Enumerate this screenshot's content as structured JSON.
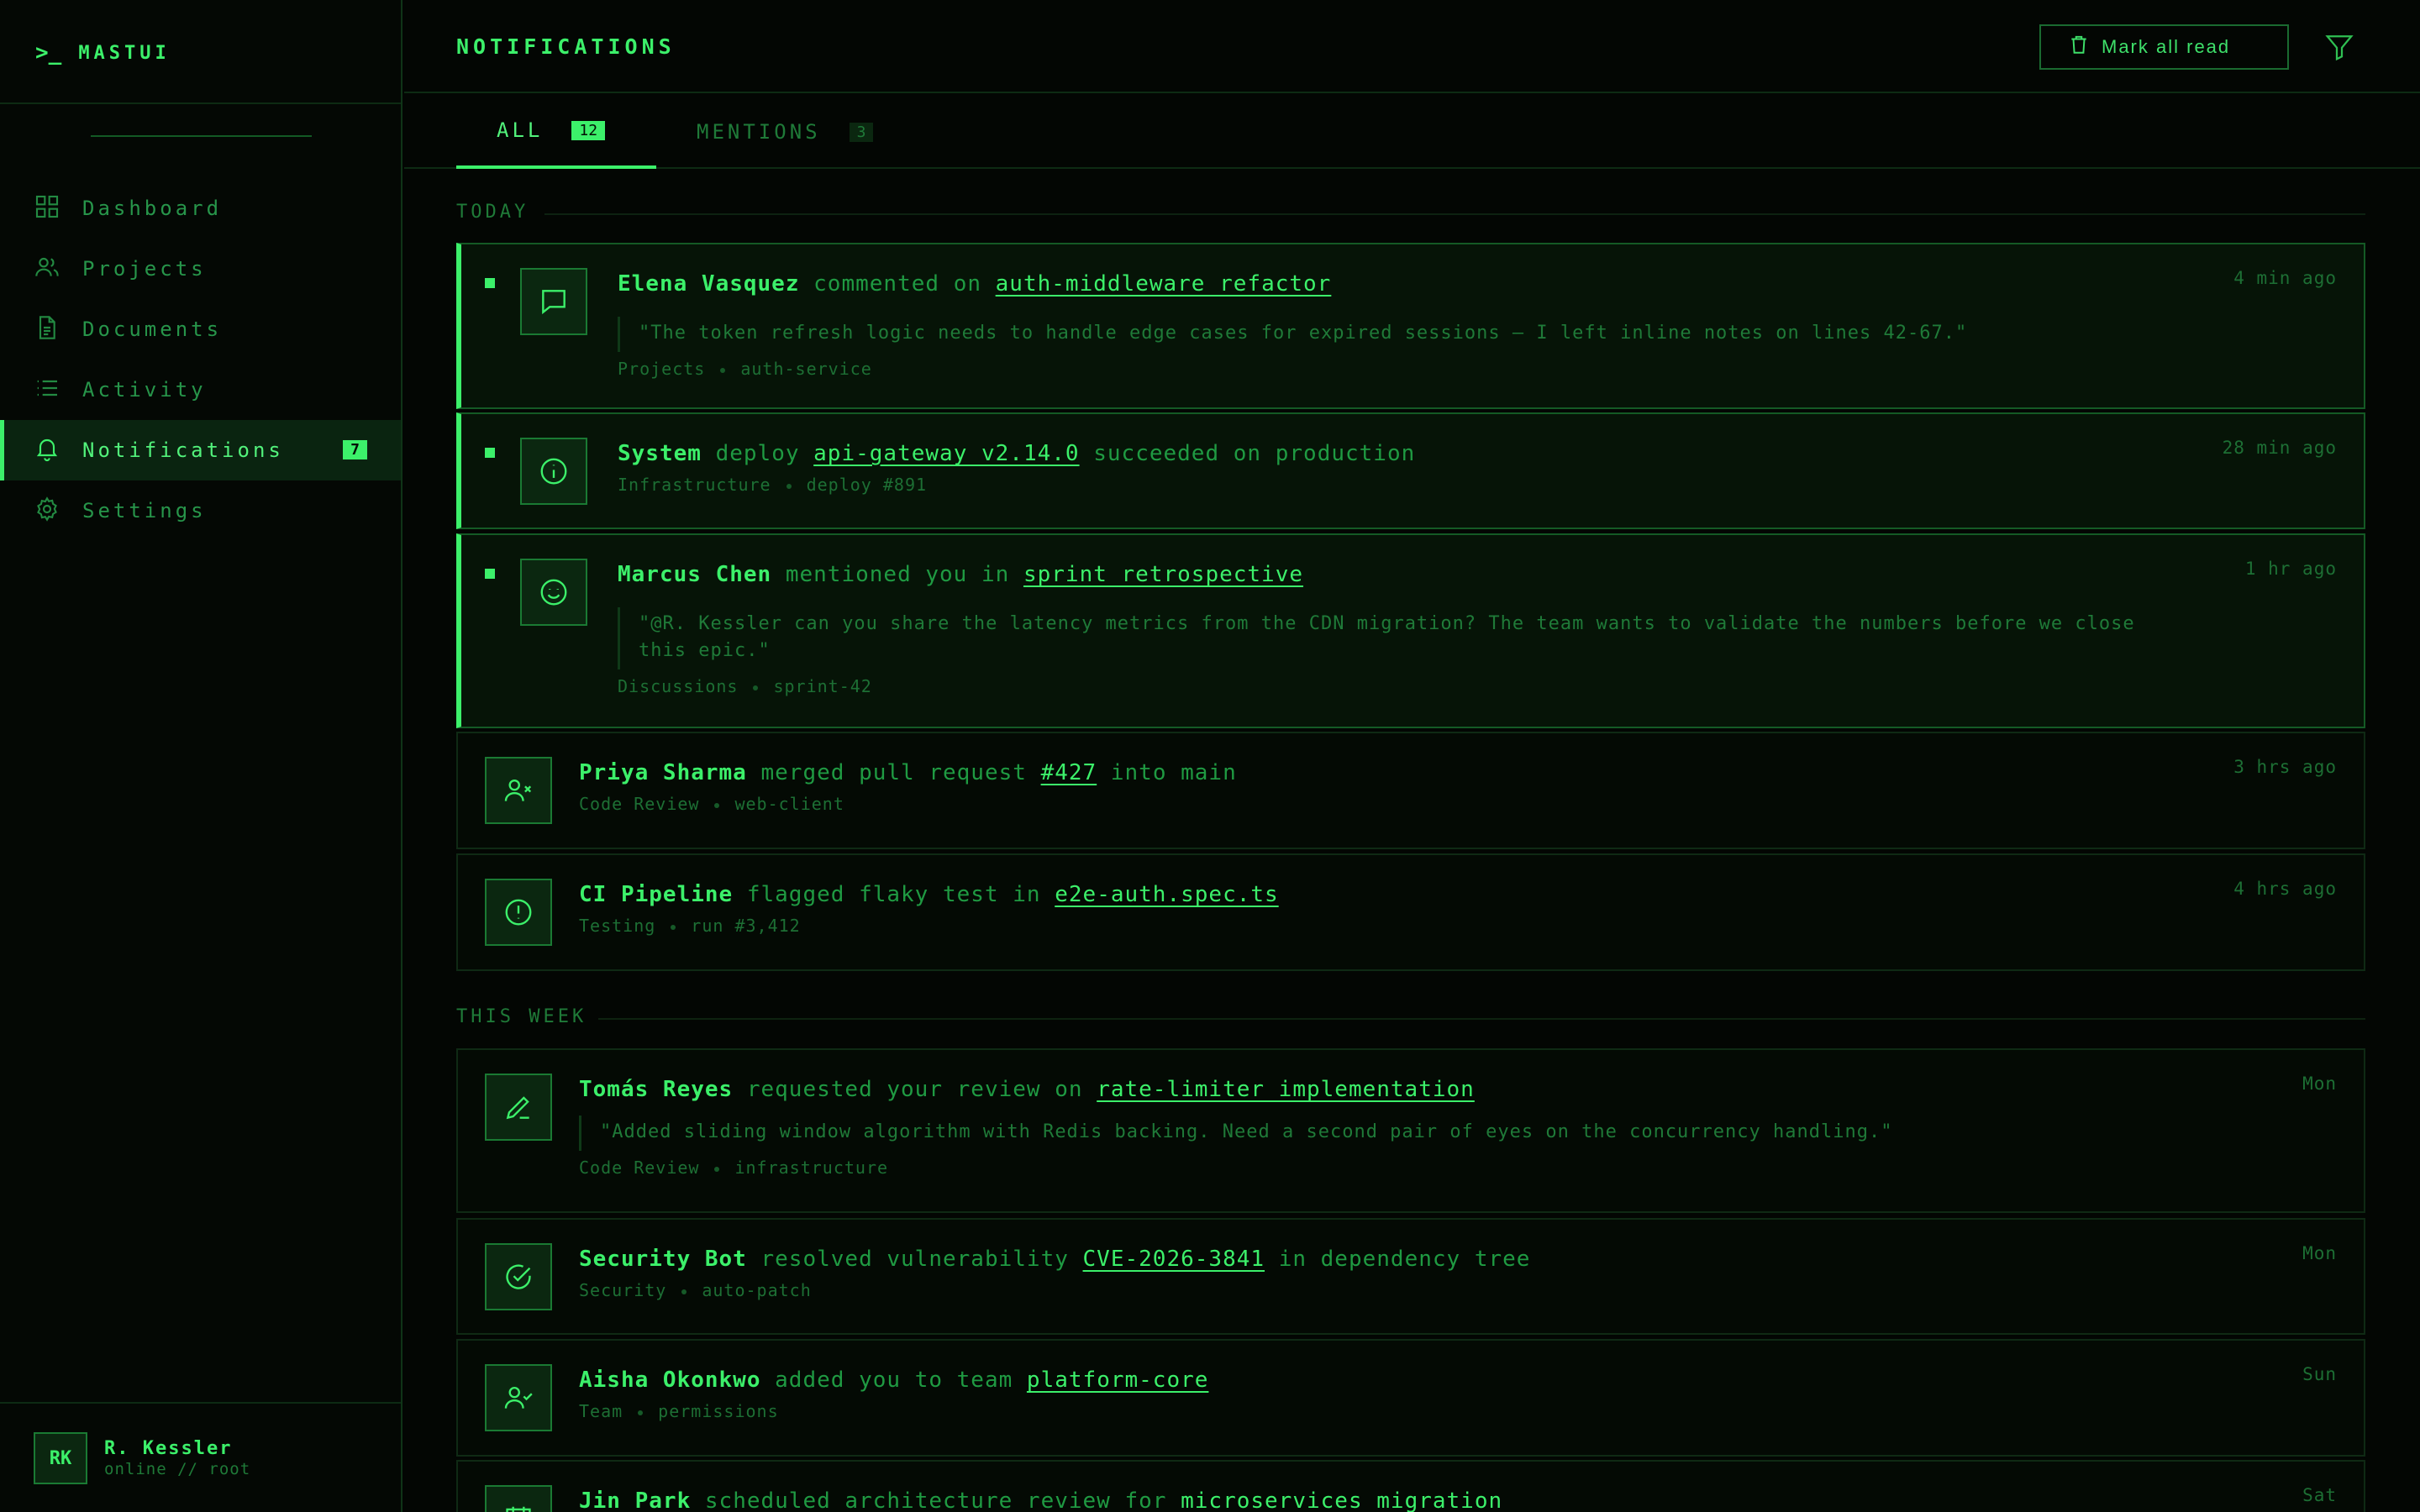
{
  "brand": {
    "prompt": ">_",
    "name": "MASTUI"
  },
  "nav": {
    "items": [
      {
        "label": "Dashboard",
        "icon": "grid-icon"
      },
      {
        "label": "Projects",
        "icon": "users-icon"
      },
      {
        "label": "Documents",
        "icon": "document-icon"
      },
      {
        "label": "Activity",
        "icon": "list-icon"
      },
      {
        "label": "Notifications",
        "icon": "bell-icon",
        "badge": "7",
        "active": true
      },
      {
        "label": "Settings",
        "icon": "gear-icon"
      }
    ]
  },
  "user": {
    "initials": "RK",
    "name": "R. Kessler",
    "status": "online // root"
  },
  "header": {
    "title": "NOTIFICATIONS",
    "mark_all_read": "Mark all read"
  },
  "tabs": [
    {
      "label": "ALL",
      "count": "12",
      "active": true
    },
    {
      "label": "MENTIONS",
      "count": "3",
      "active": false
    }
  ],
  "sections": [
    {
      "label": "TODAY",
      "items": [
        {
          "actor": "Elena Vasquez",
          "action": "commented on",
          "target": "auth-middleware refactor",
          "suffix": "",
          "quote": "\"The token refresh logic needs to handle edge cases for expired sessions — I left inline notes on lines 42-67.\"",
          "meta": [
            "Projects",
            "auth-service"
          ],
          "time": "4 min ago",
          "unread": true,
          "icon": "comment-icon"
        },
        {
          "actor": "System",
          "action": "deploy",
          "target": "api-gateway v2.14.0",
          "suffix": "succeeded on production",
          "quote": "",
          "meta": [
            "Infrastructure",
            "deploy #891"
          ],
          "time": "28 min ago",
          "unread": true,
          "icon": "info-icon"
        },
        {
          "actor": "Marcus Chen",
          "action": "mentioned you in",
          "target": "sprint retrospective",
          "suffix": "",
          "quote": "\"@R. Kessler can you share the latency metrics from the CDN migration? The team wants to validate the numbers before we close this epic.\"",
          "meta": [
            "Discussions",
            "sprint-42"
          ],
          "time": "1 hr ago",
          "unread": true,
          "icon": "smile-icon"
        },
        {
          "actor": "Priya Sharma",
          "action": "merged pull request",
          "target": "#427",
          "suffix": "into main",
          "quote": "",
          "meta": [
            "Code Review",
            "web-client"
          ],
          "time": "3 hrs ago",
          "unread": false,
          "icon": "user-x-icon"
        },
        {
          "actor": "CI Pipeline",
          "action": "flagged flaky test in",
          "target": "e2e-auth.spec.ts",
          "suffix": "",
          "quote": "",
          "meta": [
            "Testing",
            "run #3,412"
          ],
          "time": "4 hrs ago",
          "unread": false,
          "icon": "alert-icon"
        }
      ]
    },
    {
      "label": "THIS WEEK",
      "items": [
        {
          "actor": "Tomás Reyes",
          "action": "requested your review on",
          "target": "rate-limiter implementation",
          "suffix": "",
          "quote": "\"Added sliding window algorithm with Redis backing. Need a second pair of eyes on the concurrency handling.\"",
          "meta": [
            "Code Review",
            "infrastructure"
          ],
          "time": "Mon",
          "unread": false,
          "icon": "pen-icon"
        },
        {
          "actor": "Security Bot",
          "action": "resolved vulnerability",
          "target": "CVE-2026-3841",
          "suffix": "in dependency tree",
          "quote": "",
          "meta": [
            "Security",
            "auto-patch"
          ],
          "time": "Mon",
          "unread": false,
          "icon": "check-circle-icon"
        },
        {
          "actor": "Aisha Okonkwo",
          "action": "added you to team",
          "target": "platform-core",
          "suffix": "",
          "quote": "",
          "meta": [
            "Team",
            "permissions"
          ],
          "time": "Sun",
          "unread": false,
          "icon": "user-check-icon"
        },
        {
          "actor": "Jin Park",
          "action": "scheduled architecture review for",
          "target": "microservices migration",
          "suffix": "",
          "quote": "",
          "meta": [],
          "time": "Sat",
          "unread": false,
          "icon": "calendar-icon"
        }
      ]
    }
  ],
  "colors": {
    "accent": "#3cf06a",
    "background": "#030603",
    "muted": "#1f7a38",
    "panel": "#061407"
  }
}
